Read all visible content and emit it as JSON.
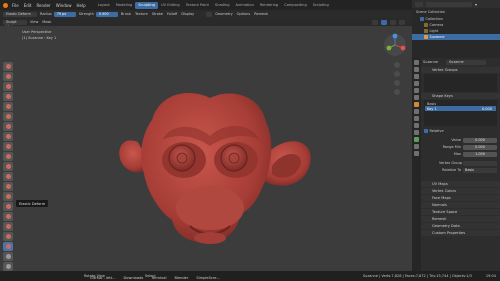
{
  "topbar": {
    "menus": [
      "File",
      "Edit",
      "Render",
      "Window",
      "Help"
    ],
    "tabs": [
      "Layout",
      "Modeling",
      "Sculpting",
      "UV Editing",
      "Texture Paint",
      "Shading",
      "Animation",
      "Rendering",
      "Compositing",
      "Scripting"
    ],
    "active_tab": "Sculpting",
    "scene": "Scene",
    "view_layer": "View Layer"
  },
  "toolheader": {
    "brush": "Elastic Deform",
    "radius_label": "Radius",
    "radius_value": "79 px",
    "strength_label": "Strength",
    "strength_value": "0.500",
    "brush_menu": "Brush",
    "texture_menu": "Texture",
    "stroke_menu": "Stroke",
    "falloff_menu": "Falloff",
    "display_menu": "Display",
    "geometry_menu": "Geometry",
    "options_menu": "Options",
    "remesh_menu": "Remesh"
  },
  "modeheader": {
    "mode": "Sculpt Mode",
    "view": "View",
    "mask": "Mask"
  },
  "viewport": {
    "perspective": "User Perspective",
    "object_info": "(1) Suzanne : Key 1",
    "accent": "#b8483f"
  },
  "tooltip": "Elastic Deform",
  "outliner": {
    "title": "Scene Collection",
    "items": [
      "Collection",
      "Camera",
      "Light",
      "Suzanne"
    ]
  },
  "properties": {
    "object_name": "Suzanne",
    "data_name": "Suzanne",
    "vertex_groups": "Vertex Groups",
    "shape_keys": "Shape Keys",
    "keys": [
      {
        "name": "Basis",
        "value": ""
      },
      {
        "name": "Key 1",
        "value": "0.000"
      }
    ],
    "relative": "Relative",
    "value_label": "Value",
    "value": "0.000",
    "range_min_label": "Range Min",
    "range_min": "0.000",
    "max_label": "Max",
    "max": "1.000",
    "vertex_group_label": "Vertex Group",
    "relative_to_label": "Relative To",
    "relative_to": "Basis",
    "sections": [
      "UV Maps",
      "Vertex Colors",
      "Face Maps",
      "Normals",
      "Texture Space",
      "Remesh",
      "Geometry Data",
      "Custom Properties"
    ]
  },
  "statusbar": {
    "left": "Rotate View",
    "center": "Select",
    "tasks": [
      "GitHub - lett...",
      "Downloads",
      "Terminal",
      "Blender",
      "SimpleScre..."
    ],
    "stats": "Suzanne | Verts:7,828 | Faces:7,872 | Tris:15,744 | Objects:1/3",
    "time": "19:04"
  }
}
